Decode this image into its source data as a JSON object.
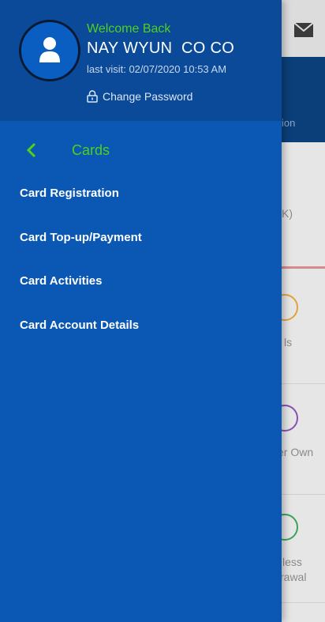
{
  "profile": {
    "welcome": "Welcome Back",
    "name": "NAY WYUN  CO CO",
    "last_visit": "last visit: 02/07/2020 10:53 AM",
    "change_password": "Change Password"
  },
  "menu": {
    "section_title": "Cards",
    "items": [
      "Card Registration",
      "Card Top-up/Payment",
      "Card Activities",
      "Card Account Details"
    ]
  },
  "background": {
    "banner_text": "ion",
    "row1": "K)",
    "row2": "ls",
    "row3": "er Own",
    "row4a": "less",
    "row4b": "rawal"
  },
  "colors": {
    "drawer": "#0a58b4",
    "header": "#0b4a98",
    "accent_green": "#4fd11a"
  }
}
